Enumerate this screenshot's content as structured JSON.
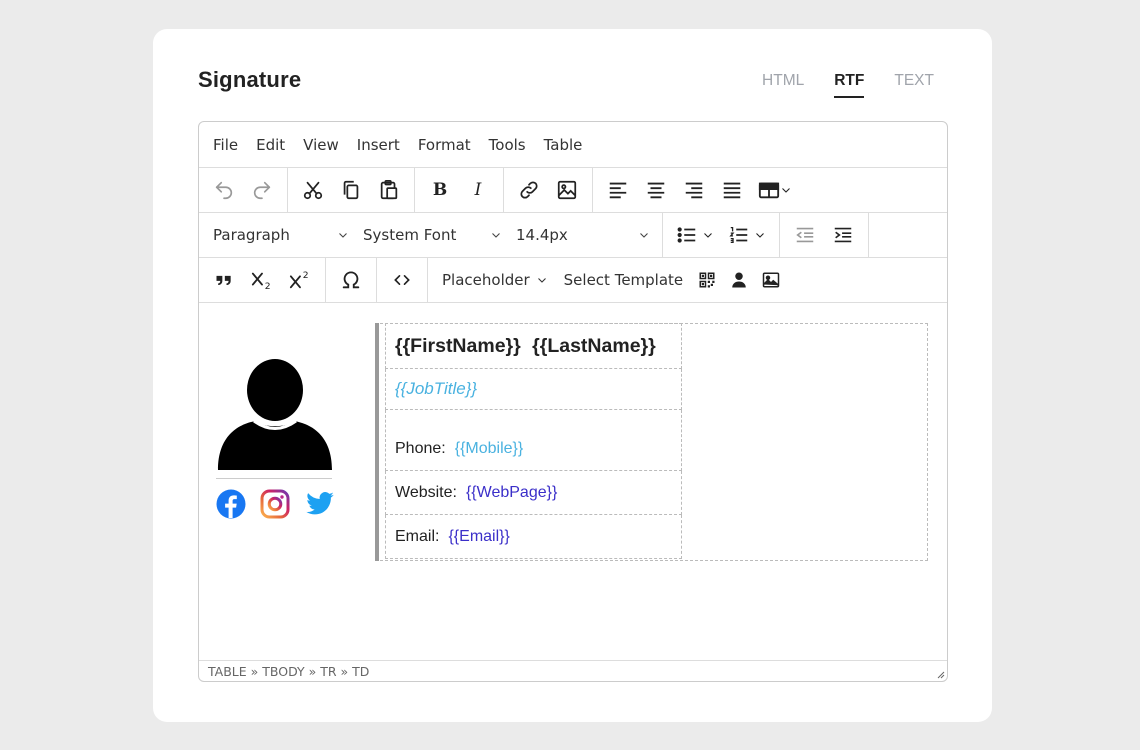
{
  "header": {
    "title": "Signature"
  },
  "tabs": [
    {
      "label": "HTML",
      "active": false
    },
    {
      "label": "RTF",
      "active": true
    },
    {
      "label": "TEXT",
      "active": false
    }
  ],
  "menubar": {
    "items": [
      "File",
      "Edit",
      "View",
      "Insert",
      "Format",
      "Tools",
      "Table"
    ]
  },
  "toolbar": {
    "block_format": "Paragraph",
    "font_family": "System Font",
    "font_size": "14.4px",
    "placeholder_label": "Placeholder",
    "template_label": "Select Template",
    "bold_label": "B",
    "italic_label": "I"
  },
  "signature": {
    "first_name": "{{FirstName}}",
    "last_name": "{{LastName}}",
    "job_title": "{{JobTitle}}",
    "phone_label": "Phone:",
    "phone_value": "{{Mobile}}",
    "website_label": "Website:",
    "website_value": "{{WebPage}}",
    "email_label": "Email:",
    "email_value": "{{Email}}"
  },
  "statusbar": {
    "path": "TABLE » TBODY » TR » TD"
  },
  "colors": {
    "accent": "#222222",
    "placeholder_blue": "#4ab2e0",
    "placeholder_indigo": "#3b2fc9",
    "facebook": "#1877f2",
    "twitter": "#1da1f2"
  }
}
